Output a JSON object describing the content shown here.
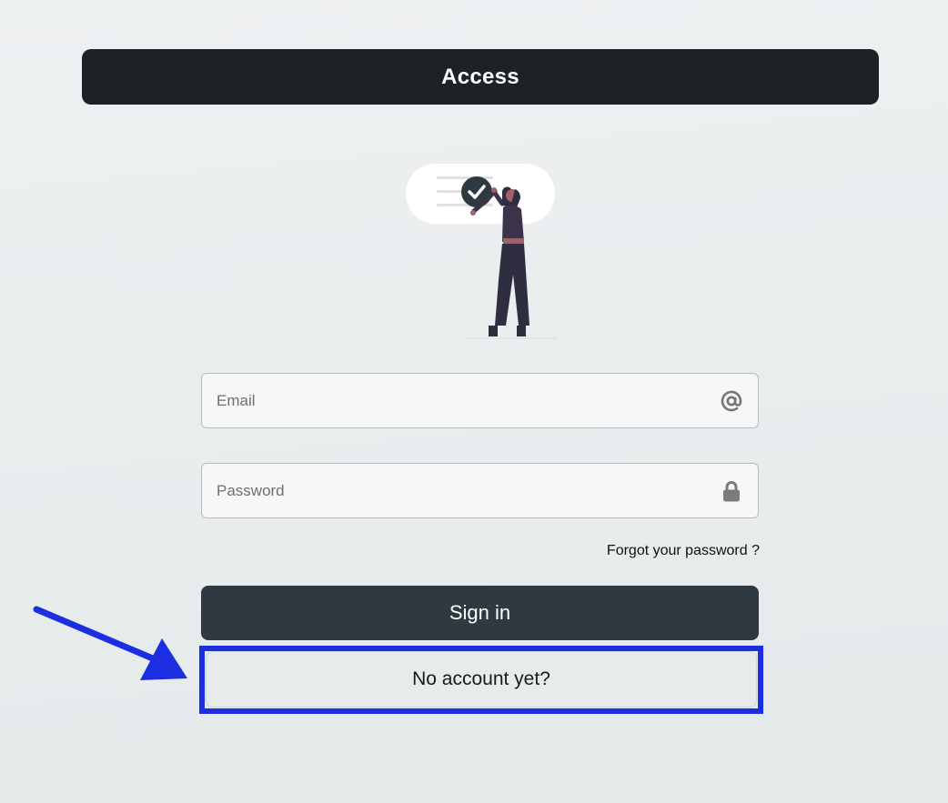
{
  "header": {
    "title": "Access"
  },
  "form": {
    "email": {
      "placeholder": "Email",
      "value": "",
      "icon": "at-icon"
    },
    "password": {
      "placeholder": "Password",
      "value": "",
      "icon": "lock-icon"
    },
    "forgot_label": "Forgot your password ?",
    "signin_label": "Sign in",
    "no_account_label": "No account yet?"
  },
  "annotation": {
    "color": "#1c2fe0"
  }
}
